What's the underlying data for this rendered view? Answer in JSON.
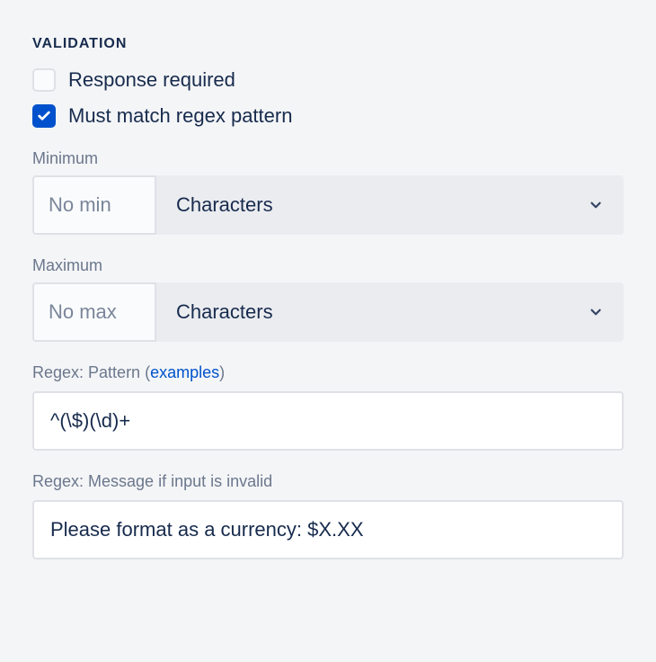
{
  "section": {
    "title": "VALIDATION"
  },
  "checkboxes": {
    "response_required": {
      "label": "Response required",
      "checked": false
    },
    "must_match_regex": {
      "label": "Must match regex pattern",
      "checked": true
    }
  },
  "minimum": {
    "label": "Minimum",
    "placeholder": "No min",
    "value": "",
    "unit": "Characters"
  },
  "maximum": {
    "label": "Maximum",
    "placeholder": "No max",
    "value": "",
    "unit": "Characters"
  },
  "regex_pattern": {
    "label_prefix": "Regex: Pattern (",
    "examples_link": "examples",
    "label_suffix": ")",
    "value": "^(\\$)(\\d)+"
  },
  "regex_message": {
    "label": "Regex: Message if input is invalid",
    "value": "Please format as a currency: $X.XX"
  }
}
